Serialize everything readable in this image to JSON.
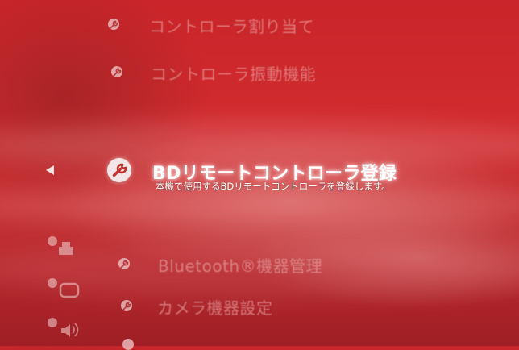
{
  "menu": {
    "items": [
      {
        "label": "コントローラ割り当て",
        "icon": "wrench-icon"
      },
      {
        "label": "コントローラ振動機能",
        "icon": "wrench-icon"
      },
      {
        "label": "BDリモートコントローラ登録",
        "icon": "wrench-icon",
        "description": "本機で使用するBDリモートコントローラを登録します。",
        "selected": true
      },
      {
        "label": "Bluetooth®機器管理",
        "icon": "wrench-icon"
      },
      {
        "label": "カメラ機器設定",
        "icon": "wrench-icon"
      }
    ]
  },
  "category_icons": [
    "printer-settings-icon",
    "display-settings-icon",
    "sound-settings-icon"
  ],
  "colors": {
    "background": "#c9252a",
    "selected_text": "#ffffff",
    "dim_text": "#eba9a9"
  }
}
